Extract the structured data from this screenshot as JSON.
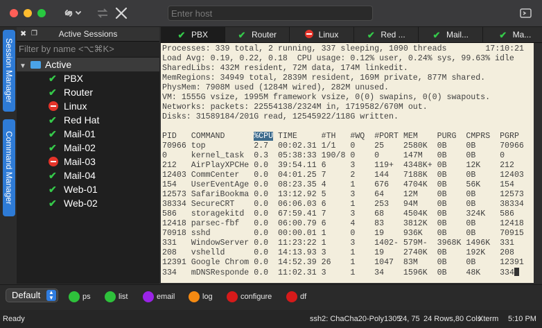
{
  "toolbar": {
    "host_placeholder": "Enter host",
    "link_icon": "link-icon",
    "disconnect_icon": "close-icon",
    "reconnect_icon": "reconnect-icon",
    "sidebar_toggle_icon": "sidebar-toggle-icon"
  },
  "rails": {
    "session_manager": "Session Manager",
    "command_manager": "Command Manager"
  },
  "sessions": {
    "title": "Active Sessions",
    "filter_placeholder": "Filter by name <⌥⌘K>",
    "folder": "Active",
    "items": [
      {
        "label": "PBX",
        "status": "connected"
      },
      {
        "label": "Router",
        "status": "connected"
      },
      {
        "label": "Linux",
        "status": "disconnected"
      },
      {
        "label": "Red Hat",
        "status": "connected"
      },
      {
        "label": "Mail-01",
        "status": "connected"
      },
      {
        "label": "Mail-02",
        "status": "connected"
      },
      {
        "label": "Mail-03",
        "status": "disconnected"
      },
      {
        "label": "Mail-04",
        "status": "connected"
      },
      {
        "label": "Web-01",
        "status": "connected"
      },
      {
        "label": "Web-02",
        "status": "connected"
      }
    ]
  },
  "tabs": [
    {
      "label": "PBX",
      "status": "connected"
    },
    {
      "label": "Router",
      "status": "connected"
    },
    {
      "label": "Linux",
      "status": "disconnected"
    },
    {
      "label": "Red ...",
      "status": "connected"
    },
    {
      "label": "Mail...",
      "status": "connected"
    },
    {
      "label": "Ma...",
      "status": "connected"
    }
  ],
  "terminal": {
    "time": "17:10:21",
    "header_lines": [
      "Processes: 339 total, 2 running, 337 sleeping, 1090 threads",
      "Load Avg: 0.19, 0.22, 0.18  CPU usage: 0.12% user, 0.24% sys, 99.63% idle",
      "SharedLibs: 432M resident, 72M data, 174M linkedit.",
      "MemRegions: 34949 total, 2839M resident, 169M private, 877M shared.",
      "PhysMem: 7908M used (1284M wired), 282M unused.",
      "VM: 1555G vsize, 1995M framework vsize, 0(0) swapins, 0(0) swapouts.",
      "Networks: packets: 22554138/2324M in, 1719582/670M out.",
      "Disks: 31589184/201G read, 12545922/118G written."
    ],
    "columns": [
      "PID",
      "COMMAND",
      "%CPU",
      "TIME",
      "#TH",
      "#WQ",
      "#PORT",
      "MEM",
      "PURG",
      "CMPRS",
      "PGRP"
    ],
    "rows": [
      [
        "70966",
        "top",
        "2.7",
        "00:02.31",
        "1/1",
        "0",
        "25",
        "2580K",
        "0B",
        "0B",
        "70966"
      ],
      [
        "0",
        "kernel_task",
        "0.3",
        "05:38:33",
        "190/8",
        "0",
        "0",
        "147M",
        "0B",
        "0B",
        "0"
      ],
      [
        "212",
        "AirPlayXPCHe",
        "0.0",
        "39:54.11",
        "6",
        "3",
        "119+",
        "4348K+",
        "0B",
        "12K",
        "212"
      ],
      [
        "12403",
        "CommCenter",
        "0.0",
        "04:01.25",
        "7",
        "2",
        "144",
        "7188K",
        "0B",
        "0B",
        "12403"
      ],
      [
        "154",
        "UserEventAge",
        "0.0",
        "08:23.35",
        "4",
        "1",
        "676",
        "4704K",
        "0B",
        "56K",
        "154"
      ],
      [
        "12573",
        "SafariBookma",
        "0.0",
        "13:12.92",
        "5",
        "3",
        "64",
        "12M",
        "0B",
        "0B",
        "12573"
      ],
      [
        "38334",
        "SecureCRT",
        "0.0",
        "06:06.03",
        "6",
        "1",
        "253",
        "94M",
        "0B",
        "0B",
        "38334"
      ],
      [
        "586",
        "storagekitd",
        "0.0",
        "67:59.41",
        "7",
        "3",
        "68",
        "4504K",
        "0B",
        "324K",
        "586"
      ],
      [
        "12418",
        "parsec-fbf",
        "0.0",
        "06:00.79",
        "6",
        "4",
        "83",
        "3812K",
        "0B",
        "0B",
        "12418"
      ],
      [
        "70918",
        "sshd",
        "0.0",
        "00:00.01",
        "1",
        "0",
        "19",
        "936K",
        "0B",
        "0B",
        "70915"
      ],
      [
        "331",
        "WindowServer",
        "0.0",
        "11:23:22",
        "1",
        "3",
        "1402-",
        "579M-",
        "3968K",
        "1496K",
        "331"
      ],
      [
        "208",
        "vshelld",
        "0.0",
        "14:13.93",
        "3",
        "1",
        "19",
        "2740K",
        "0B",
        "192K",
        "208"
      ],
      [
        "12391",
        "Google Chrom",
        "0.0",
        "14:52.39",
        "26",
        "1",
        "1047",
        "83M",
        "0B",
        "0B",
        "12391"
      ],
      [
        "334",
        "mDNSResponde",
        "0.0",
        "11:02.31",
        "3",
        "1",
        "34",
        "1596K",
        "0B",
        "48K",
        "334"
      ]
    ]
  },
  "buttonbar": {
    "default_label": "Default",
    "buttons": [
      {
        "label": "ps",
        "color": "#2ec13b"
      },
      {
        "label": "list",
        "color": "#2ec13b"
      },
      {
        "label": "email",
        "color": "#9a23e6"
      },
      {
        "label": "log",
        "color": "#f58a12"
      },
      {
        "label": "configure",
        "color": "#d61a1a"
      },
      {
        "label": "df",
        "color": "#d61a1a"
      }
    ]
  },
  "status": {
    "left": "Ready",
    "cipher": "ssh2: ChaCha20-Poly1305",
    "cursor": "24, 75",
    "size": "24 Rows,80 Cols",
    "term": "Xterm",
    "time": "5:10 PM"
  },
  "colors": {
    "accent": "#2e7bd6",
    "connected": "#35c94a",
    "disconnected": "#e5342a",
    "terminal_bg": "#f3eedd"
  }
}
